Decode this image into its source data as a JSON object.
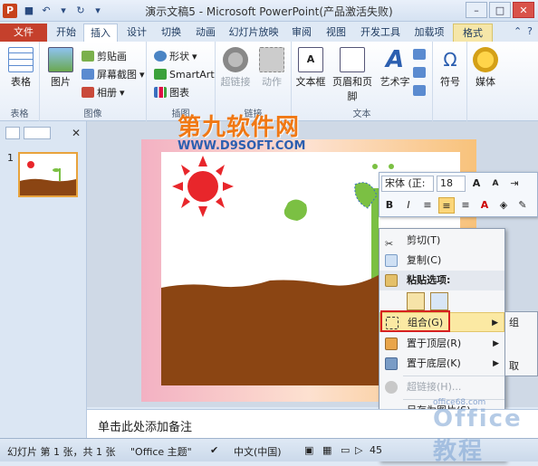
{
  "window": {
    "title": "演示文稿5 - Microsoft PowerPoint(产品激活失败)",
    "app_icon": "P",
    "qat": [
      "save-icon",
      "undo-icon",
      "undo-dropdown-icon",
      "redo-icon",
      "customize-icon"
    ],
    "controls": [
      "minimize",
      "maximize",
      "close"
    ]
  },
  "tabs": [
    {
      "label": "文件"
    },
    {
      "label": "开始"
    },
    {
      "label": "插入"
    },
    {
      "label": "设计"
    },
    {
      "label": "切换"
    },
    {
      "label": "动画"
    },
    {
      "label": "幻灯片放映"
    },
    {
      "label": "审阅"
    },
    {
      "label": "视图"
    },
    {
      "label": "开发工具"
    },
    {
      "label": "加载项"
    },
    {
      "label": "格式"
    }
  ],
  "ribbon": {
    "table": {
      "btn": "表格",
      "group": "表格"
    },
    "images": {
      "picture": "图片",
      "clipart": "剪贴画",
      "screenshot": "屏幕截图",
      "album": "相册",
      "group": "图像"
    },
    "illustrations": {
      "shapes": "形状",
      "smartart": "SmartArt",
      "chart": "图表",
      "group": "插图"
    },
    "links": {
      "hyperlink": "超链接",
      "action": "动作",
      "group": "链接"
    },
    "text": {
      "textbox": "文本框",
      "headerfooter": "页眉和页脚",
      "wordart": "艺术字",
      "group": "文本"
    },
    "symbols": {
      "symbol": "符号"
    },
    "media": {
      "media": "媒体"
    }
  },
  "slides_panel": {
    "slide_number": "1"
  },
  "watermark": {
    "brand": "第九软件网",
    "url": "WWW.D9SOFT.COM"
  },
  "notes": {
    "placeholder": "单击此处添加备注"
  },
  "status": {
    "slide": "幻灯片 第 1 张，共 1 张",
    "theme": "\"Office 主题\"",
    "lang": "中文(中国)",
    "zoom": "45"
  },
  "mini_toolbar": {
    "font": "宋体 (正:",
    "size": "18",
    "buttons_row1": [
      "A↑",
      "A↓",
      "indent"
    ],
    "buttons_row2": [
      "B",
      "I",
      "≡",
      "≡",
      "≡",
      "A",
      "fill",
      "line"
    ]
  },
  "context_menu": {
    "items": [
      {
        "label": "剪切(T)",
        "type": "normal"
      },
      {
        "label": "复制(C)",
        "type": "normal"
      },
      {
        "label": "粘贴选项:",
        "type": "header"
      },
      {
        "label": "",
        "type": "paste"
      },
      {
        "label": "组合(G)",
        "type": "highlight",
        "arrow": true
      },
      {
        "label": "置于顶层(R)",
        "type": "normal",
        "arrow": true
      },
      {
        "label": "置于底层(K)",
        "type": "normal",
        "arrow": true
      },
      {
        "label": "超链接(H)...",
        "type": "disabled"
      },
      {
        "label": "另存为图片(S)...",
        "type": "normal"
      }
    ],
    "submenu": [
      "组",
      "",
      "取"
    ]
  },
  "site_watermark": {
    "text": "Office教程",
    "small": "office68.com"
  },
  "colors": {
    "file_tab": "#c5402c",
    "highlight": "#fbe9a3",
    "redbox": "#d62020",
    "soil": "#8b4513",
    "sun": "#e8262b",
    "leaf": "#7bc043"
  }
}
